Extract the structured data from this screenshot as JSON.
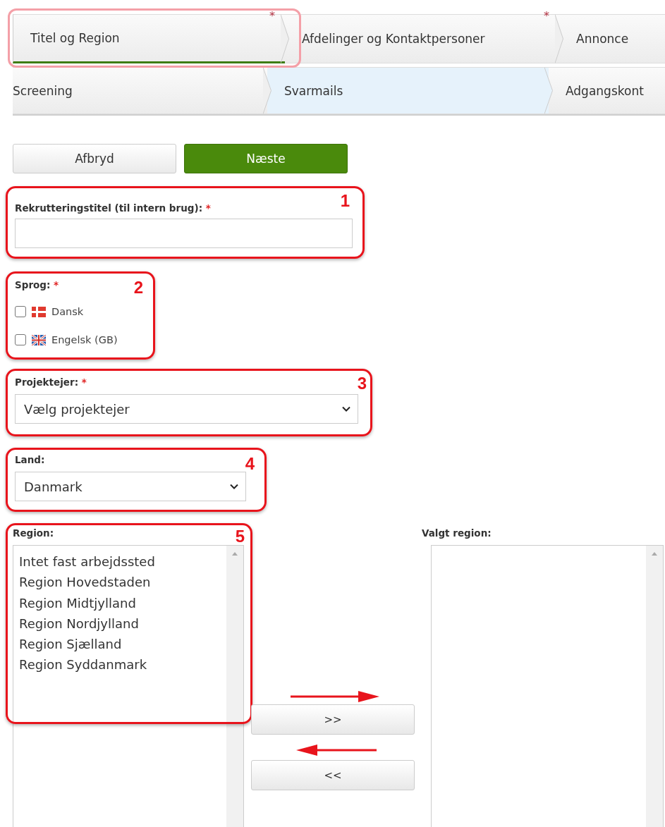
{
  "tab_rows": [
    {
      "tabs": [
        {
          "label": "Titel og Region",
          "selected": true,
          "current": false,
          "highlighted": true,
          "required_mark": "*"
        },
        {
          "label": "Afdelinger og Kontaktpersoner",
          "selected": false,
          "current": false,
          "highlighted": false,
          "required_mark": "*"
        },
        {
          "label": "Annonce",
          "selected": false,
          "current": false,
          "highlighted": false
        }
      ]
    },
    {
      "tabs": [
        {
          "label": "Screening",
          "selected": false,
          "current": false,
          "highlighted": false
        },
        {
          "label": "Svarmails",
          "selected": false,
          "current": true,
          "highlighted": false
        },
        {
          "label": "Adgangskont",
          "selected": false,
          "current": false,
          "highlighted": false
        }
      ]
    }
  ],
  "buttons": [
    {
      "label": "Afbryd",
      "kind": "secondary"
    },
    {
      "label": "Næste",
      "kind": "primary"
    }
  ],
  "title_field": {
    "label": "Rekrutteringstitel (til intern brug):",
    "required_mark": "*",
    "marker": "1"
  },
  "language": {
    "label": "Sprog:",
    "required_mark": "*",
    "marker": "2",
    "options": [
      {
        "label": "Dansk",
        "kind": "dk",
        "checked": false
      },
      {
        "label": "Engelsk (GB)",
        "kind": "gb",
        "checked": false
      }
    ]
  },
  "owner": {
    "label": "Projektejer:",
    "required_mark": "*",
    "marker": "3",
    "value": "Vælg projektejer"
  },
  "country": {
    "label": "Land:",
    "marker": "4",
    "value": "Danmark"
  },
  "region": {
    "label": "Region:",
    "marker": "5",
    "options": [
      {
        "label": "Intet fast arbejdssted",
        "selected": false
      },
      {
        "label": "Region Hovedstaden",
        "selected": false
      },
      {
        "label": "Region Midtjylland",
        "selected": false
      },
      {
        "label": "Region Nordjylland",
        "selected": false
      },
      {
        "label": "Region Sjælland",
        "selected": false
      },
      {
        "label": "Region Syddanmark",
        "selected": false
      }
    ]
  },
  "transfer_buttons": [
    {
      "label": ">>"
    },
    {
      "label": "<<"
    }
  ],
  "selected_region": {
    "label": "Valgt region:"
  }
}
